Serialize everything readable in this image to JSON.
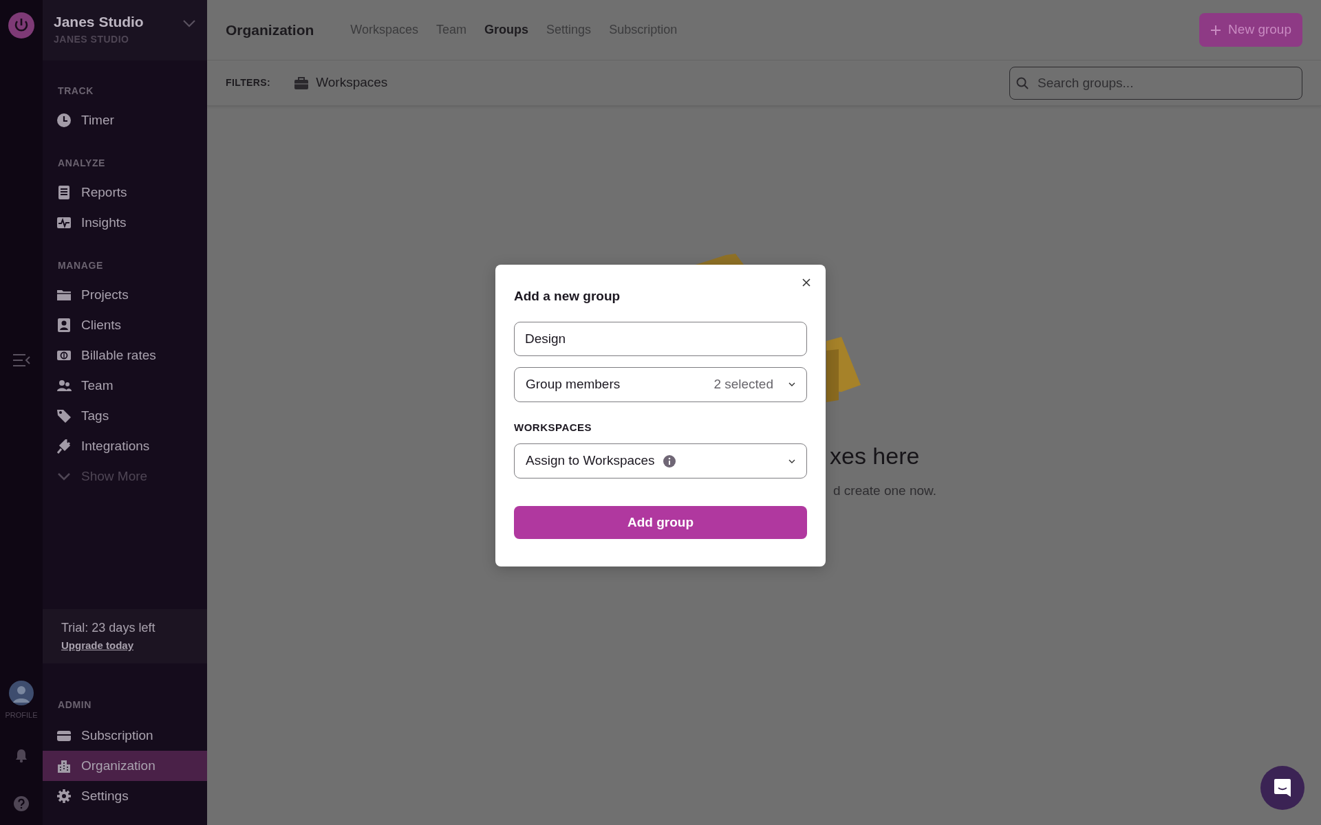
{
  "rail": {
    "profile_label": "PROFILE"
  },
  "workspace": {
    "name": "Janes Studio",
    "subtitle": "JANES STUDIO"
  },
  "sidebar": {
    "sections": [
      {
        "heading": "TRACK",
        "items": [
          {
            "label": "Timer",
            "kind": "link",
            "selected": false
          }
        ]
      },
      {
        "heading": "ANALYZE",
        "items": [
          {
            "label": "Reports",
            "kind": "link",
            "selected": false
          },
          {
            "label": "Insights",
            "kind": "link",
            "selected": false
          }
        ]
      },
      {
        "heading": "MANAGE",
        "items": [
          {
            "label": "Projects",
            "kind": "link",
            "selected": false
          },
          {
            "label": "Clients",
            "kind": "link",
            "selected": false
          },
          {
            "label": "Billable rates",
            "kind": "link",
            "selected": false
          },
          {
            "label": "Team",
            "kind": "link",
            "selected": false
          },
          {
            "label": "Tags",
            "kind": "link",
            "selected": false
          },
          {
            "label": "Integrations",
            "kind": "link",
            "selected": false
          },
          {
            "label": "Show More",
            "kind": "more",
            "selected": false
          }
        ]
      }
    ],
    "trial": {
      "text": "Trial: 23 days left",
      "link": "Upgrade today"
    },
    "admin": {
      "heading": "ADMIN",
      "items": [
        {
          "label": "Subscription",
          "kind": "link",
          "selected": false
        },
        {
          "label": "Organization",
          "kind": "link",
          "selected": true
        },
        {
          "label": "Settings",
          "kind": "link",
          "selected": false
        }
      ]
    }
  },
  "header": {
    "title": "Organization",
    "tabs": [
      {
        "label": "Workspaces",
        "selected": false
      },
      {
        "label": "Team",
        "selected": false
      },
      {
        "label": "Groups",
        "selected": true
      },
      {
        "label": "Settings",
        "selected": false
      },
      {
        "label": "Subscription",
        "selected": false
      }
    ],
    "new_button": "New group"
  },
  "filters": {
    "label": "FILTERS:",
    "chip": "Workspaces",
    "search": {
      "placeholder": "Search groups..."
    }
  },
  "empty_state": {
    "heading": "xes here",
    "text": "d create one now."
  },
  "modal": {
    "title": "Add a new group",
    "name": {
      "value": "Design"
    },
    "members": {
      "label": "Group members",
      "value": "2 selected"
    },
    "section": "WORKSPACES",
    "workspaces": {
      "label": "Assign to Workspaces"
    },
    "submit": "Add group"
  }
}
